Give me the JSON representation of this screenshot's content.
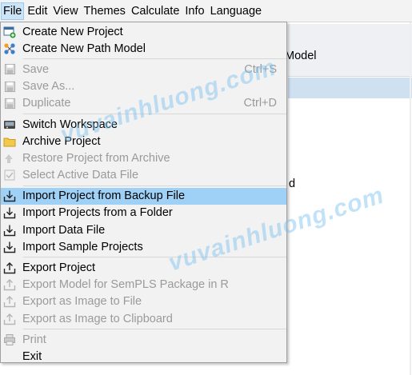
{
  "menubar": {
    "items": [
      "File",
      "Edit",
      "View",
      "Themes",
      "Calculate",
      "Info",
      "Language"
    ]
  },
  "background": {
    "header_text": "Model",
    "fragment_text": "d"
  },
  "file_menu": {
    "items": [
      {
        "label": "Create New Project",
        "shortcut": "",
        "icon": "new-project-icon",
        "enabled": true
      },
      {
        "label": "Create New Path Model",
        "shortcut": "",
        "icon": "path-model-icon",
        "enabled": true
      },
      {
        "label": "Save",
        "shortcut": "Ctrl+S",
        "icon": "save-icon",
        "enabled": false
      },
      {
        "label": "Save As...",
        "shortcut": "",
        "icon": "save-as-icon",
        "enabled": false
      },
      {
        "label": "Duplicate",
        "shortcut": "Ctrl+D",
        "icon": "duplicate-icon",
        "enabled": false
      },
      {
        "label": "Switch Workspace",
        "shortcut": "",
        "icon": "workspace-icon",
        "enabled": true
      },
      {
        "label": "Archive Project",
        "shortcut": "",
        "icon": "folder-icon",
        "enabled": true
      },
      {
        "label": "Restore Project from Archive",
        "shortcut": "",
        "icon": "restore-icon",
        "enabled": false
      },
      {
        "label": "Select Active Data File",
        "shortcut": "",
        "icon": "data-file-icon",
        "enabled": false
      },
      {
        "label": "Import Project from Backup File",
        "shortcut": "",
        "icon": "import-icon",
        "enabled": true
      },
      {
        "label": "Import Projects from a Folder",
        "shortcut": "",
        "icon": "import-icon",
        "enabled": true
      },
      {
        "label": "Import Data File",
        "shortcut": "",
        "icon": "import-icon",
        "enabled": true
      },
      {
        "label": "Import Sample Projects",
        "shortcut": "",
        "icon": "import-icon",
        "enabled": true
      },
      {
        "label": "Export Project",
        "shortcut": "",
        "icon": "export-icon",
        "enabled": true
      },
      {
        "label": "Export Model for SemPLS Package in R",
        "shortcut": "",
        "icon": "export-icon",
        "enabled": false
      },
      {
        "label": "Export as Image to File",
        "shortcut": "",
        "icon": "export-icon",
        "enabled": false
      },
      {
        "label": "Export as Image to Clipboard",
        "shortcut": "",
        "icon": "export-icon",
        "enabled": false
      },
      {
        "label": "Print",
        "shortcut": "",
        "icon": "print-icon",
        "enabled": false
      },
      {
        "label": "Exit",
        "shortcut": "",
        "icon": "",
        "enabled": true
      }
    ]
  },
  "watermark": {
    "text": "vuvainhluong.com"
  },
  "colors": {
    "highlight": "#9fd0f5",
    "menu_bg": "#f2f2f2",
    "disabled_text": "#9a9a9a"
  }
}
